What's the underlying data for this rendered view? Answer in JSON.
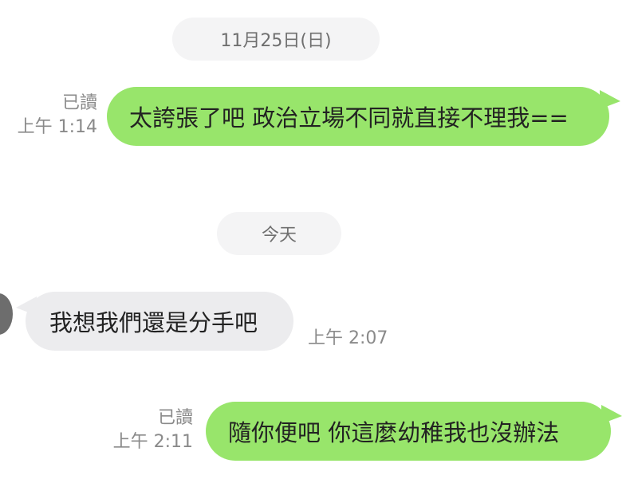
{
  "chat": {
    "date_dividers": {
      "first": "11月25日(日)",
      "second": "今天"
    },
    "messages": [
      {
        "text": "太誇張了吧 政治立場不同就直接不理我==",
        "direction": "outgoing",
        "status": "已讀",
        "time": "上午 1:14"
      },
      {
        "text": "我想我們還是分手吧",
        "direction": "incoming",
        "time": "上午 2:07"
      },
      {
        "text": "隨你便吧 你這麼幼稚我也沒辦法",
        "direction": "outgoing",
        "status": "已讀",
        "time": "上午 2:11"
      }
    ],
    "colors": {
      "outgoing_bubble": "#98e56b",
      "incoming_bubble": "#ececee",
      "meta_text": "#8a8a8a"
    }
  }
}
